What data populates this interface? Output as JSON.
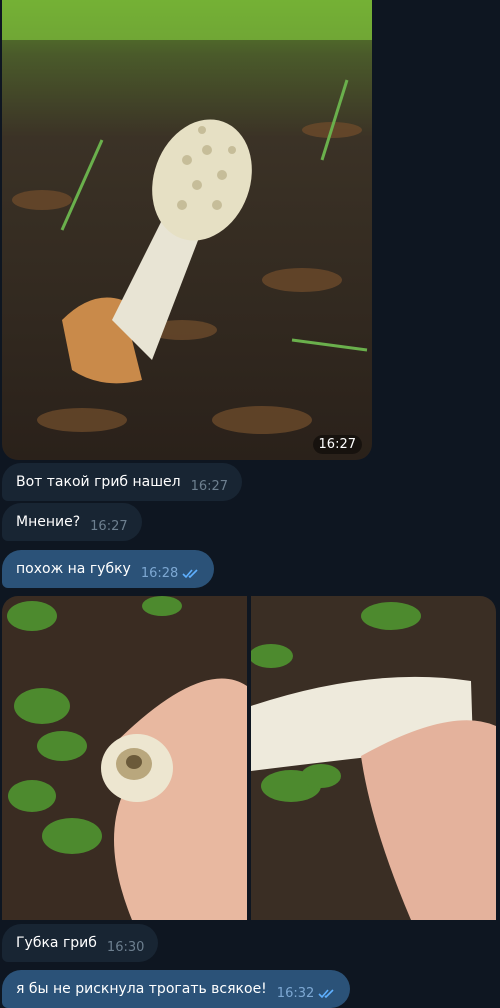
{
  "chat": {
    "messages": [
      {
        "type": "photo",
        "time": "16:27",
        "direction": "incoming",
        "description": "mushroom in forest"
      },
      {
        "type": "text",
        "text": "Вот такой гриб нашел",
        "time": "16:27",
        "direction": "incoming"
      },
      {
        "type": "text",
        "text": "Мнение?",
        "time": "16:27",
        "direction": "incoming"
      },
      {
        "type": "text",
        "text": "похож на губку",
        "time": "16:28",
        "direction": "outgoing",
        "status": "read"
      },
      {
        "type": "album",
        "direction": "incoming",
        "photos": 2
      },
      {
        "type": "text",
        "text": "Губка гриб",
        "time": "16:30",
        "direction": "incoming"
      },
      {
        "type": "text",
        "text": "я бы не рискнула трогать всякое!",
        "time": "16:32",
        "direction": "outgoing",
        "status": "read"
      }
    ]
  },
  "colors": {
    "background": "#0e1621",
    "incoming_bubble": "#182533",
    "outgoing_bubble": "#2b5278",
    "read_checks": "#5fb0ff"
  },
  "icons": {
    "read_receipt": "double-check-icon"
  }
}
